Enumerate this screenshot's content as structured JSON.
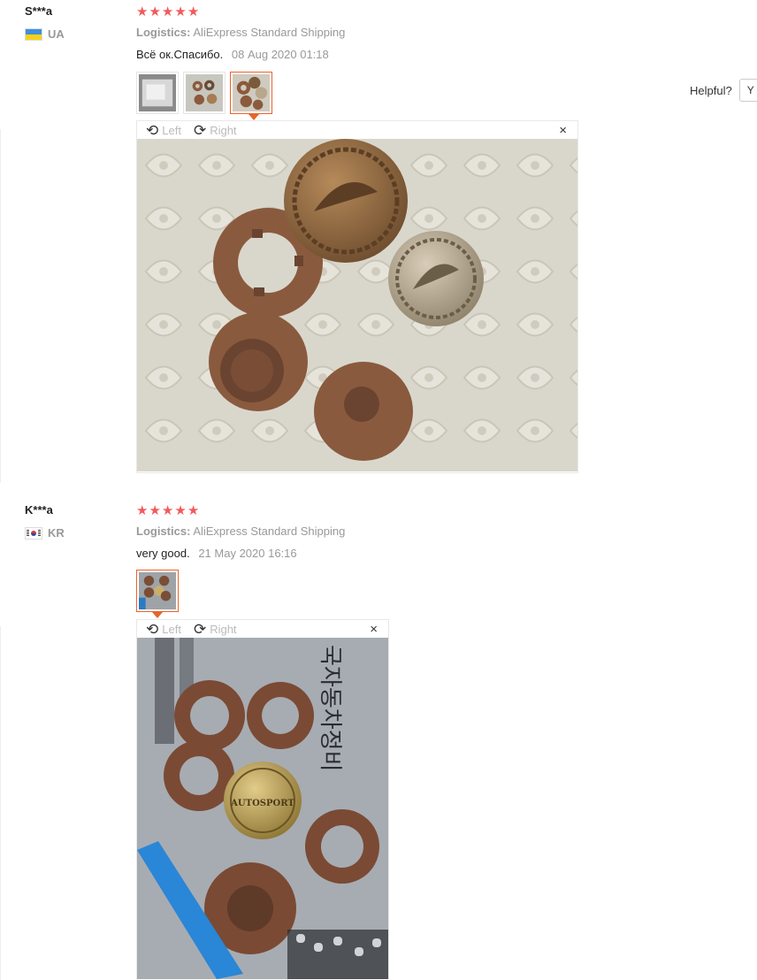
{
  "reviews": [
    {
      "user": "S***a",
      "country": "UA",
      "stars": [
        "★",
        "★",
        "★",
        "★",
        "★"
      ],
      "logistics_label": "Logistics:",
      "logistics_value": "AliExpress Standard Shipping",
      "comment": "Всё ок.Спасибо.",
      "date": "08 Aug 2020 01:18",
      "rotate_left": "Left",
      "rotate_right": "Right",
      "close": "×",
      "rotate_left_glyph": "⟲",
      "rotate_right_glyph": "⟳"
    },
    {
      "user": "K***a",
      "country": "KR",
      "stars": [
        "★",
        "★",
        "★",
        "★",
        "★"
      ],
      "logistics_label": "Logistics:",
      "logistics_value": "AliExpress Standard Shipping",
      "comment": "very good.",
      "date": "21 May 2020 16:16",
      "rotate_left": "Left",
      "rotate_right": "Right",
      "close": "×",
      "rotate_left_glyph": "⟲",
      "rotate_right_glyph": "⟳"
    }
  ],
  "helpful": {
    "label": "Helpful?",
    "yes": "Y"
  },
  "photo_text": {
    "autosport": "AUTOSPORT",
    "korean_sign": "국자동차정비"
  },
  "colors": {
    "star": "#f25a5a",
    "accent_orange": "#e8642a",
    "muted": "#999999",
    "button_brown": "#8b5a3c"
  }
}
